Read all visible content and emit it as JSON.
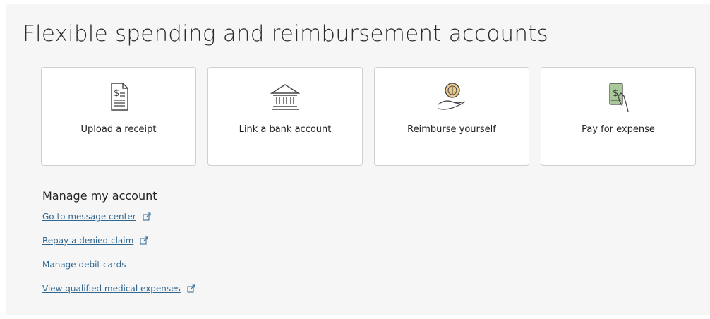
{
  "page": {
    "title": "Flexible spending and reimbursement accounts"
  },
  "cards": [
    {
      "label": "Upload a receipt",
      "icon": "receipt-icon"
    },
    {
      "label": "Link a bank account",
      "icon": "bank-icon"
    },
    {
      "label": "Reimburse yourself",
      "icon": "hand-coin-icon"
    },
    {
      "label": "Pay for expense",
      "icon": "phone-payment-icon"
    }
  ],
  "manage": {
    "title": "Manage my account",
    "links": [
      {
        "label": "Go to message center",
        "external": true
      },
      {
        "label": "Repay a denied claim",
        "external": true
      },
      {
        "label": "Manage debit cards",
        "external": false
      },
      {
        "label": "View qualified medical expenses",
        "external": true
      }
    ]
  },
  "colors": {
    "link": "#2f6690",
    "accent_green": "#a9c99b",
    "accent_gold": "#e9c98a"
  }
}
